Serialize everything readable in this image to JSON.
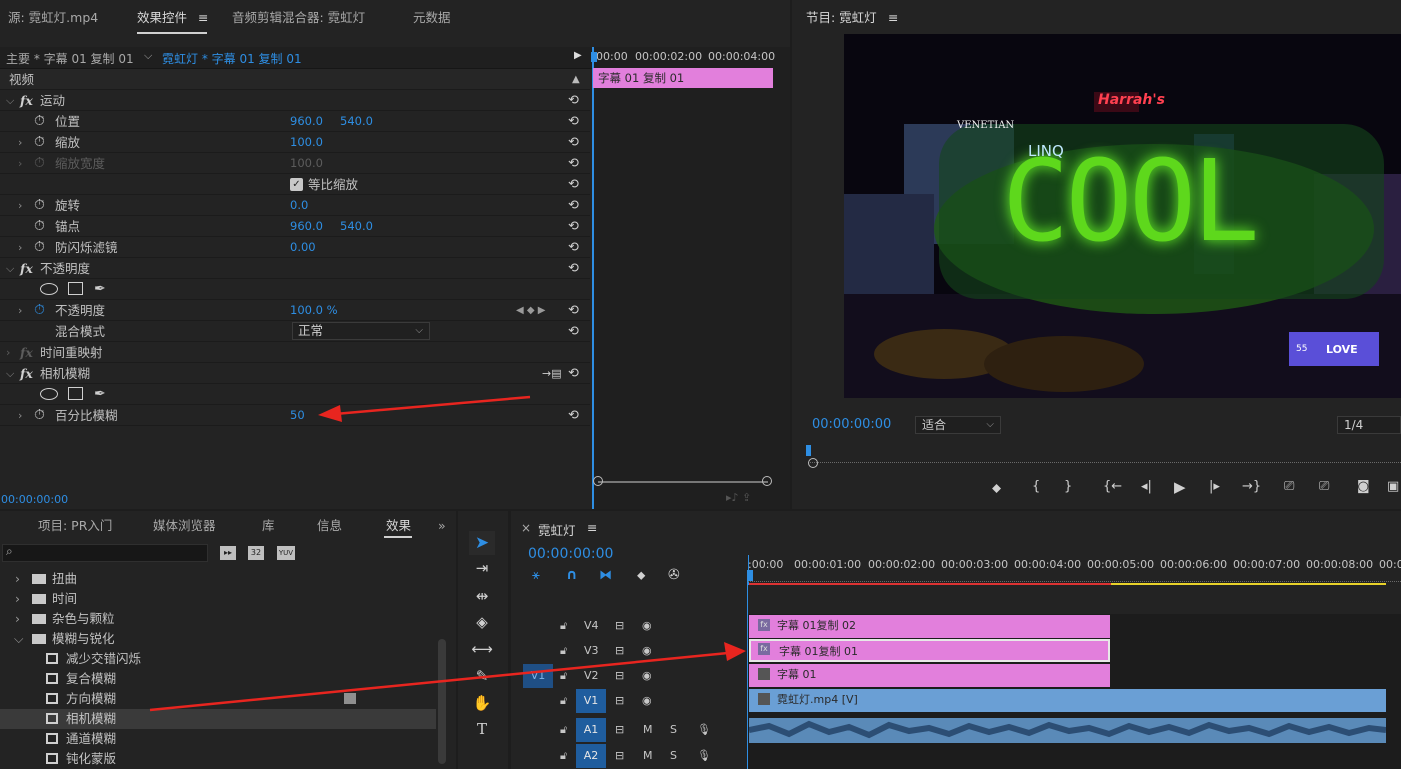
{
  "source_panel": {
    "tabs": [
      {
        "label": "源: 霓虹灯.mp4",
        "active": false
      },
      {
        "label": "效果控件",
        "active": true
      },
      {
        "label": "音频剪辑混合器: 霓虹灯",
        "active": false
      },
      {
        "label": "元数据",
        "active": false
      }
    ],
    "menu_icon": "≡",
    "master_clip": "主要 * 字幕 01 复制 01",
    "sequence_clip": "霓虹灯 * 字幕 01 复制 01",
    "section_video": "视频",
    "ruler": [
      "00:00",
      "00:00:02:00",
      "00:00:04:00"
    ],
    "clip_bar": "字幕 01 复制 01",
    "timecode": "00:00:00:00",
    "effects": {
      "motion": "运动",
      "position_label": "位置",
      "position_x": "960.0",
      "position_y": "540.0",
      "scale_label": "缩放",
      "scale_value": "100.0",
      "scale_width_label": "缩放宽度",
      "scale_width_value": "100.0",
      "uniform_scale_label": "等比缩放",
      "uniform_scale_checked": true,
      "rotation_label": "旋转",
      "rotation_value": "0.0",
      "anchor_label": "锚点",
      "anchor_x": "960.0",
      "anchor_y": "540.0",
      "antiflicker_label": "防闪烁滤镜",
      "antiflicker_value": "0.00",
      "opacity_group": "不透明度",
      "opacity_label": "不透明度",
      "opacity_value": "100.0 %",
      "blend_label": "混合模式",
      "blend_value": "正常",
      "time_remap": "时间重映射",
      "camera_blur": "相机模糊",
      "blur_percent_label": "百分比模糊",
      "blur_percent_value": "50"
    }
  },
  "program_panel": {
    "title": "节目: 霓虹灯",
    "menu_icon": "≡",
    "timecode": "00:00:00:00",
    "fit": "适合",
    "page": "1/4",
    "video_text": "COOL",
    "sign_venetian": "VENETIAN",
    "sign_harrahs": "Harrah's",
    "sign_linq": "LINQ",
    "sign_love": "LOVE",
    "sign_55": "55"
  },
  "project_panel": {
    "tabs": [
      {
        "label": "项目: PR入门",
        "active": false
      },
      {
        "label": "媒体浏览器",
        "active": false
      },
      {
        "label": "库",
        "active": false
      },
      {
        "label": "信息",
        "active": false
      },
      {
        "label": "效果",
        "active": true
      }
    ],
    "more": "»",
    "search_icon": "⌕",
    "badges": [
      "32",
      "YUV"
    ],
    "items": [
      {
        "label": "扭曲",
        "type": "folder",
        "expanded": false
      },
      {
        "label": "时间",
        "type": "folder",
        "expanded": false
      },
      {
        "label": "杂色与颗粒",
        "type": "folder",
        "expanded": false
      },
      {
        "label": "模糊与锐化",
        "type": "folder",
        "expanded": true
      },
      {
        "label": "减少交错闪烁",
        "type": "effect"
      },
      {
        "label": "复合模糊",
        "type": "effect"
      },
      {
        "label": "方向模糊",
        "type": "effect"
      },
      {
        "label": "相机模糊",
        "type": "effect",
        "selected": true
      },
      {
        "label": "通道模糊",
        "type": "effect"
      },
      {
        "label": "钝化蒙版",
        "type": "effect"
      }
    ]
  },
  "timeline": {
    "title": "霓虹灯",
    "close": "×",
    "menu_icon": "≡",
    "timecode": "00:00:00:00",
    "ruler": [
      ":00:00",
      "00:00:01:00",
      "00:00:02:00",
      "00:00:03:00",
      "00:00:04:00",
      "00:00:05:00",
      "00:00:06:00",
      "00:00:07:00",
      "00:00:08:00",
      "00:0"
    ],
    "tracks": [
      {
        "name": "V4",
        "target": false
      },
      {
        "name": "V3",
        "target": false
      },
      {
        "name": "V2",
        "target": false,
        "source": "V1"
      },
      {
        "name": "V1",
        "target": true
      },
      {
        "name": "A1",
        "target": true,
        "m": "M",
        "s": "S"
      },
      {
        "name": "A2",
        "target": true,
        "m": "M",
        "s": "S"
      }
    ],
    "clips": {
      "v4": "字幕 01复制 02",
      "v3": "字幕 01复制 01",
      "v2": "字幕 01",
      "v1": "霓虹灯.mp4 [V]",
      "fx_badge": "fx"
    }
  },
  "colors": {
    "accent": "#2e8ee3",
    "title_clip": "#e27fdc",
    "video_clip": "#6a9fd5",
    "annotation_arrow": "#e8251f",
    "neon_green": "#5ed81c"
  }
}
